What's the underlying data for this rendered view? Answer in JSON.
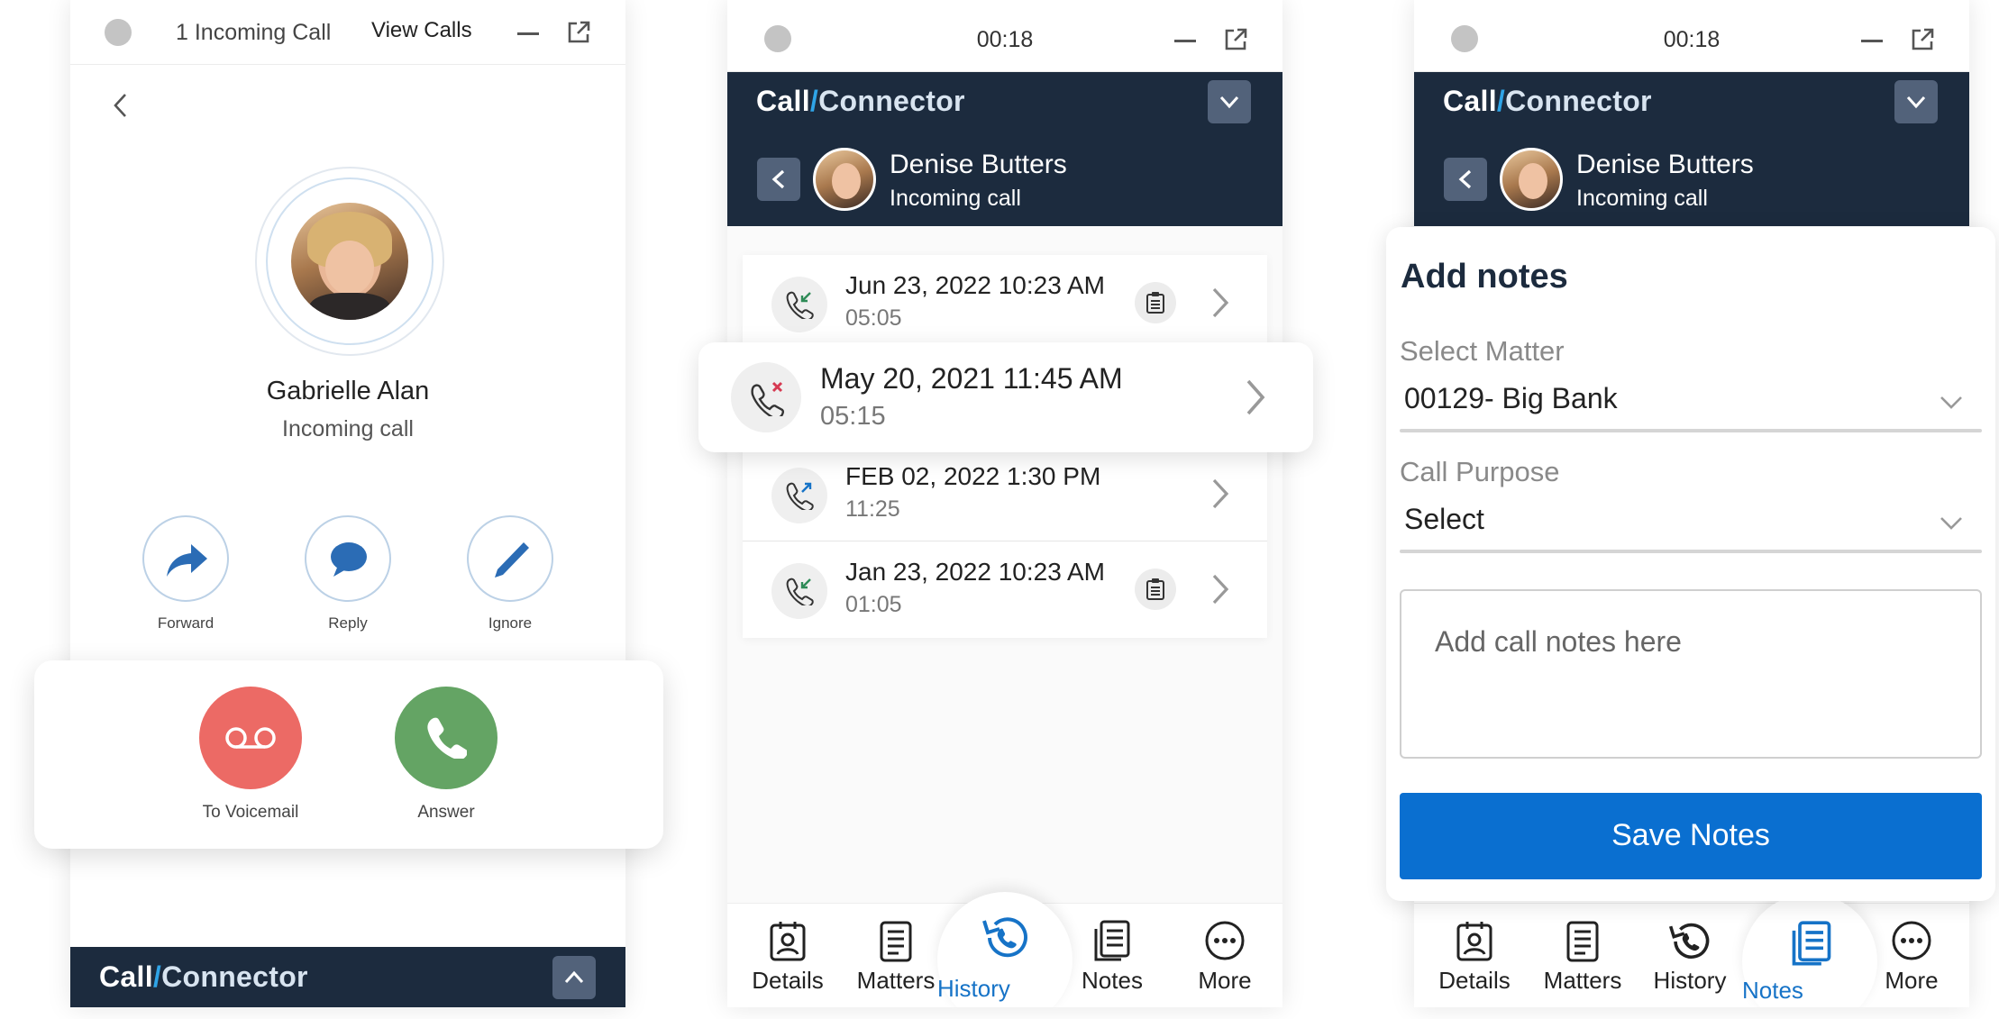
{
  "incoming_screen": {
    "topbar": {
      "count_label": "1 Incoming Call",
      "view_calls": "View Calls"
    },
    "caller": {
      "name": "Gabrielle Alan",
      "status": "Incoming call"
    },
    "actions": [
      {
        "label": "Forward",
        "icon": "forward-icon"
      },
      {
        "label": "Reply",
        "icon": "chat-bubble-icon"
      },
      {
        "label": "Ignore",
        "icon": "pencil-icon"
      }
    ],
    "primary_actions": [
      {
        "label": "To Voicemail",
        "icon": "voicemail-icon",
        "color": "#ec6a65"
      },
      {
        "label": "Answer",
        "icon": "phone-icon",
        "color": "#64a464"
      }
    ],
    "footer": {
      "brand_call": "Call",
      "brand_slash": "/",
      "brand_connector": "Connector",
      "chevron": "chevron-up-icon"
    }
  },
  "history_screen": {
    "timer": "00:18",
    "brand": {
      "call": "Call",
      "slash": "/",
      "connector": "Connector"
    },
    "caller": {
      "name": "Denise Butters",
      "status": "Incoming call"
    },
    "rows": [
      {
        "date": "Jun 23, 2022 10:23 AM",
        "duration": "05:05",
        "type": "incoming",
        "has_note": true
      },
      {
        "date": "May 20, 2021 11:45 AM",
        "duration": "05:15",
        "type": "missed",
        "has_note": false
      },
      {
        "date": "FEB 02, 2022 1:30 PM",
        "duration": "11:25",
        "type": "outgoing",
        "has_note": false
      },
      {
        "date": "Jan 23, 2022 10:23 AM",
        "duration": "01:05",
        "type": "incoming",
        "has_note": true
      }
    ],
    "nav": [
      "Details",
      "Matters",
      "History",
      "Notes",
      "More"
    ],
    "active_tab": "History"
  },
  "notes_screen": {
    "timer": "00:18",
    "brand": {
      "call": "Call",
      "slash": "/",
      "connector": "Connector"
    },
    "caller": {
      "name": "Denise Butters",
      "status": "Incoming call"
    },
    "title": "Add notes",
    "matter_label": "Select Matter",
    "matter_value": "00129- Big Bank",
    "purpose_label": "Call Purpose",
    "purpose_value": "Select",
    "notes_placeholder": "Add call notes here",
    "save_label": "Save Notes",
    "nav": [
      "Details",
      "Matters",
      "History",
      "Notes",
      "More"
    ],
    "active_tab": "Notes"
  },
  "colors": {
    "header_navy": "#1c2b3e",
    "accent_blue": "#1673c7",
    "save_button": "#0a6fd0",
    "voicemail_red": "#ec6a65",
    "answer_green": "#64a464"
  }
}
